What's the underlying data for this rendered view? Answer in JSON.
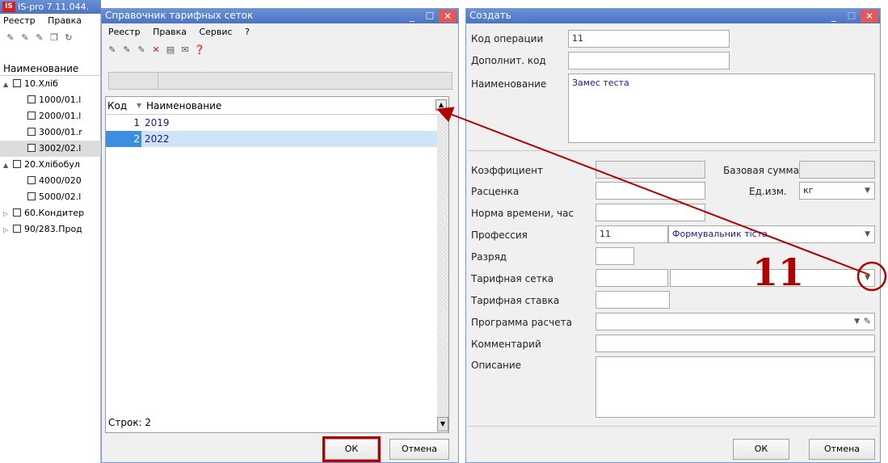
{
  "main": {
    "title": "IS-pro 7.11.044.",
    "logo": "IS",
    "menu": [
      "Реестр",
      "Правка"
    ],
    "tree_header": "Наименование",
    "tree": [
      {
        "label": "10.Хліб",
        "level": 0,
        "arrow": "▲"
      },
      {
        "label": "1000/01.l",
        "level": 1,
        "arrow": ""
      },
      {
        "label": "2000/01.l",
        "level": 1,
        "arrow": ""
      },
      {
        "label": "3000/01.r",
        "level": 1,
        "arrow": ""
      },
      {
        "label": "3002/02.l",
        "level": 1,
        "arrow": "",
        "selected": true
      },
      {
        "label": "20.Хлібобул",
        "level": 0,
        "arrow": "▲"
      },
      {
        "label": "4000/020",
        "level": 1,
        "arrow": ""
      },
      {
        "label": "5000/02.l",
        "level": 1,
        "arrow": ""
      },
      {
        "label": "60.Кондитер",
        "level": 0,
        "arrow": "▷"
      },
      {
        "label": "90/283.Прод",
        "level": 0,
        "arrow": "▷"
      }
    ]
  },
  "dialog": {
    "title": "Справочник тарифных сеток",
    "menu": [
      "Реестр",
      "Правка",
      "Сервис",
      "?"
    ],
    "col_code": "Код",
    "col_name": "Наименование",
    "rows": [
      {
        "code": "1",
        "name": "2019"
      },
      {
        "code": "2",
        "name": "2022"
      }
    ],
    "count_label": "Строк: 2",
    "ok": "ОК",
    "cancel": "Отмена"
  },
  "form": {
    "title": "Создать",
    "op_code_label": "Код операции",
    "op_code_value": "11",
    "add_code_label": "Дополнит. код",
    "name_label": "Наименование",
    "name_value": "Замес теста",
    "coef_label": "Коэффициент",
    "base_sum_label": "Базовая сумма",
    "rate_label": "Расценка",
    "unit_label": "Ед.изм.",
    "unit_value": "кг",
    "norm_label": "Норма времени, час",
    "prof_label": "Профессия",
    "prof_code": "11",
    "prof_name": "Формувальник тіста",
    "grade_label": "Разряд",
    "grid_label": "Тарифная сетка",
    "trate_label": "Тарифная ставка",
    "prog_label": "Программа расчета",
    "comment_label": "Комментарий",
    "desc_label": "Описание",
    "ok": "ОК",
    "cancel": "Отмена"
  },
  "annotation": {
    "step": "11",
    "color": "#b00000"
  }
}
